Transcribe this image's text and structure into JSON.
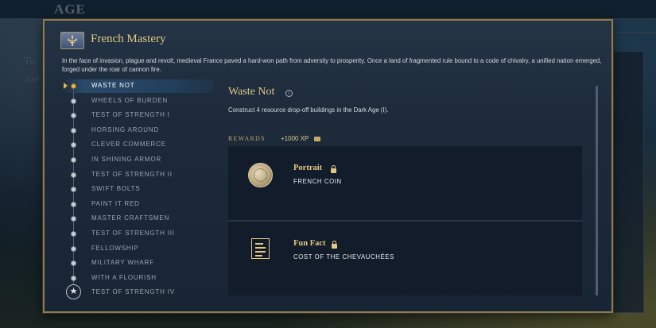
{
  "background": {
    "title": "AGE",
    "side_heading": "To",
    "side_sub": "EXP"
  },
  "modal": {
    "title": "French Mastery",
    "description": "In the face of invasion, plague and revolt, medieval France paved a hard-won path from adversity to prosperity. Once a land of fragmented rule bound to a code of chivalry, a unified nation emerged, forged under the roar of cannon fire."
  },
  "challenges": [
    {
      "label": "WASTE NOT",
      "active": true
    },
    {
      "label": "WHEELS OF BURDEN"
    },
    {
      "label": "TEST OF STRENGTH I"
    },
    {
      "label": "HORSING AROUND"
    },
    {
      "label": "CLEVER COMMERCE"
    },
    {
      "label": "IN SHINING ARMOR"
    },
    {
      "label": "TEST OF STRENGTH II"
    },
    {
      "label": "SWIFT BOLTS"
    },
    {
      "label": "PAINT IT RED"
    },
    {
      "label": "MASTER CRAFTSMEN"
    },
    {
      "label": "TEST OF STRENGTH III"
    },
    {
      "label": "FELLOWSHIP"
    },
    {
      "label": "MILITARY WHARF"
    },
    {
      "label": "WITH A FLOURISH"
    },
    {
      "label": "TEST OF STRENGTH IV",
      "final": true
    }
  ],
  "detail": {
    "title": "Waste Not",
    "info_glyph": "i",
    "description": "Construct 4 resource drop-off buildings in the Dark Age (I).",
    "rewards_label": "REWARDS",
    "xp": "+1000 XP",
    "rewards": [
      {
        "name": "Portrait",
        "sub": "FRENCH COIN",
        "icon": "coin-icon"
      },
      {
        "name": "Fun Fact",
        "sub": "COST OF THE CHEVAUCHÉES",
        "icon": "document-icon"
      }
    ]
  },
  "colors": {
    "accent_gold": "#e2c882",
    "active_row": "#22405e",
    "border": "#8a7a55"
  }
}
